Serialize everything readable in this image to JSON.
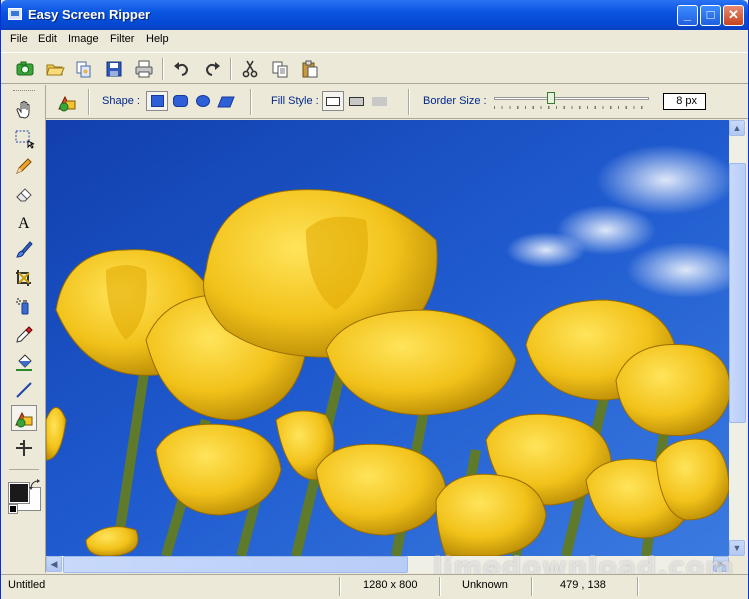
{
  "window": {
    "title": "Easy Screen Ripper"
  },
  "menu": [
    "File",
    "Edit",
    "Image",
    "Filter",
    "Help"
  ],
  "toolbar_icons": [
    "capture-icon",
    "open-folder-icon",
    "copy-file-icon",
    "save-icon",
    "print-icon",
    "undo-icon",
    "redo-icon",
    "cut-icon",
    "copy-icon",
    "paste-icon"
  ],
  "palette_icons": [
    "hand-icon",
    "select-rect-icon",
    "pencil-icon",
    "eraser-icon",
    "text-icon",
    "brush-icon",
    "crop-icon",
    "spray-icon",
    "eyedropper-icon",
    "fill-bucket-icon",
    "line-icon",
    "shape-icon",
    "move-icon"
  ],
  "options": {
    "shape_label": "Shape :",
    "fill_label": "Fill Style :",
    "border_label": "Border Size :",
    "border_value": "8 px",
    "border_fraction": 0.37
  },
  "colors": {
    "primary": "#1a1a1a",
    "secondary": "#ffffff",
    "accent": "#0a55e1"
  },
  "status": {
    "filename": "Untitled",
    "dimensions": "1280 x 800",
    "format": "Unknown",
    "coords": "479 , 138"
  },
  "watermark": "limedownload.com"
}
